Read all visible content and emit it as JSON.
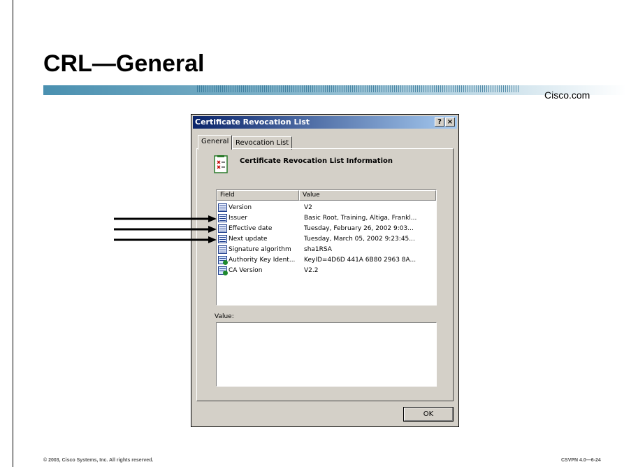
{
  "slide": {
    "title": "CRL—General",
    "brand": "Cisco.com",
    "footer_left": "© 2003, Cisco Systems, Inc. All rights reserved.",
    "footer_right": "CSVPN 4.0—6-24",
    "accent_color": "#4a90b0"
  },
  "dialog": {
    "title": "Certificate Revocation List",
    "help_button": "?",
    "close_button": "×",
    "tabs": [
      {
        "label": "General",
        "active": true
      },
      {
        "label": "Revocation List",
        "active": false
      }
    ],
    "info_title": "Certificate Revocation List Information",
    "info_icon": "certificate-list-icon",
    "list": {
      "columns": [
        "Field",
        "Value"
      ],
      "rows": [
        {
          "field": "Version",
          "value": "V2",
          "icon": "field-icon"
        },
        {
          "field": "Issuer",
          "value": "Basic Root, Training, Altiga, Frankl...",
          "icon": "field-icon"
        },
        {
          "field": "Effective date",
          "value": "Tuesday, February 26, 2002 9:03...",
          "icon": "field-icon"
        },
        {
          "field": "Next update",
          "value": "Tuesday, March 05, 2002 9:23:45...",
          "icon": "field-icon"
        },
        {
          "field": "Signature algorithm",
          "value": "sha1RSA",
          "icon": "field-icon"
        },
        {
          "field": "Authority Key Ident...",
          "value": "KeyID=4D6D 441A 6B80 2963 8A...",
          "icon": "extension-icon"
        },
        {
          "field": "CA Version",
          "value": "V2.2",
          "icon": "extension-icon"
        }
      ]
    },
    "value_label": "Value:",
    "ok_label": "OK"
  }
}
